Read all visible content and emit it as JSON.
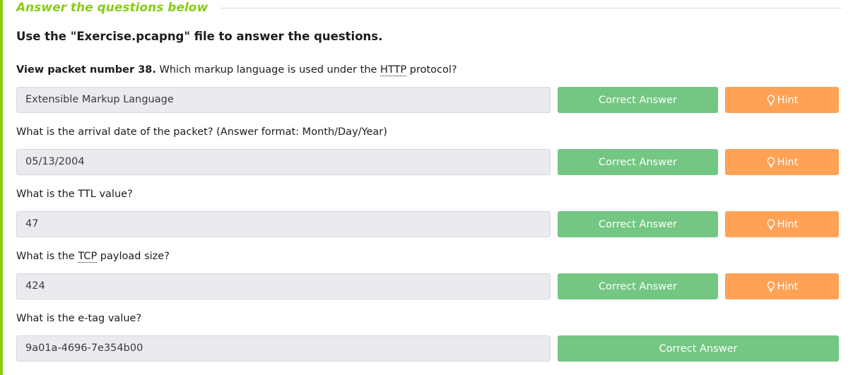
{
  "section": {
    "title": "Answer the questions below"
  },
  "instruction": "Use the \"Exercise.pcapng\" file to answer the questions.",
  "questions": [
    {
      "prefix_bold": "View packet number 38.",
      "text_before": " Which markup language is used under the ",
      "abbr": "HTTP",
      "text_after": " protocol?",
      "answer": "Extensible Markup Language",
      "button": "Correct Answer",
      "hint": "Hint"
    },
    {
      "text": "What is the arrival date of the packet? (Answer format: Month/Day/Year)",
      "answer": "05/13/2004",
      "button": "Correct Answer",
      "hint": "Hint"
    },
    {
      "text": "What is the TTL value?",
      "answer": "47",
      "button": "Correct Answer",
      "hint": "Hint"
    },
    {
      "text_before": "What is the ",
      "abbr": "TCP",
      "text_after": " payload size?",
      "answer": "424",
      "button": "Correct Answer",
      "hint": "Hint"
    },
    {
      "text": "What is the e-tag value?",
      "answer": "9a01a-4696-7e354b00",
      "button": "Correct Answer"
    }
  ],
  "colors": {
    "accent": "#88cc14",
    "correct": "#74c683",
    "hint": "#ffa256",
    "field_bg": "#e9ebee"
  },
  "icons": {
    "hint": "lightbulb-icon"
  }
}
